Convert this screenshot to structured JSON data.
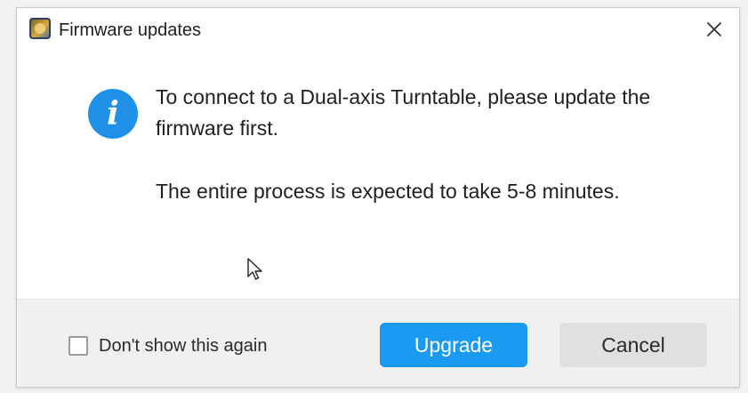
{
  "window": {
    "title": "Firmware updates",
    "app_icon": "turntable-app-icon",
    "close_icon": "close-icon"
  },
  "content": {
    "info_icon": "info-icon",
    "info_glyph": "i",
    "message_line1": "To connect to a Dual-axis Turntable, please update the firmware first.",
    "message_line2": "The entire process is expected to take 5-8 minutes."
  },
  "footer": {
    "checkbox_label": "Don't show this again",
    "checkbox_checked": false,
    "upgrade_label": "Upgrade",
    "cancel_label": "Cancel"
  },
  "colors": {
    "accent": "#1a9af0",
    "info_icon": "#1e90e8",
    "secondary_button": "#e0e0e0",
    "footer_bg": "#f0f0f0"
  }
}
